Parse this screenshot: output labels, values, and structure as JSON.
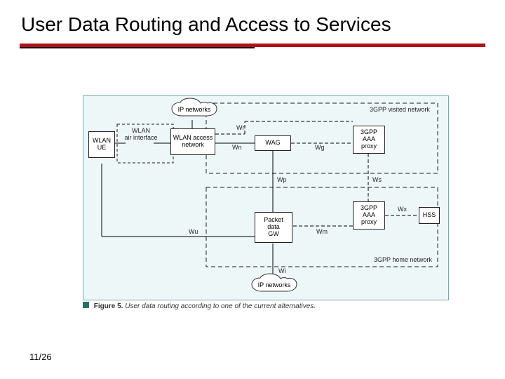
{
  "title": "User Data Routing and Access to Services",
  "rule_color": "#b01015",
  "page_number": "11/26",
  "figure": {
    "caption_bold": "Figure 5.",
    "caption_rest": " User data routing according to one of the current alternatives.",
    "nodes": {
      "wlan_ue": "WLAN\nUE",
      "wlan_air_if": "WLAN\nair interface",
      "wlan_access_net": "WLAN access\nnetwork",
      "ip_top": "IP networks",
      "ip_bottom": "IP networks",
      "wag": "WAG",
      "aaa_visited": "3GPP\nAAA\nproxy",
      "aaa_home": "3GPP\nAAA\nproxy",
      "packet_gw": "Packet\ndata\nGW",
      "hss": "HSS"
    },
    "regions": {
      "visited": "3GPP visited network",
      "home": "3GPP home network"
    },
    "ifaces": {
      "wr": "Wr",
      "wn": "Wn",
      "wp": "Wp",
      "wg": "Wg",
      "ws": "Ws",
      "wx": "Wx",
      "wm": "Wm",
      "wi": "Wi",
      "wu": "Wu"
    }
  }
}
